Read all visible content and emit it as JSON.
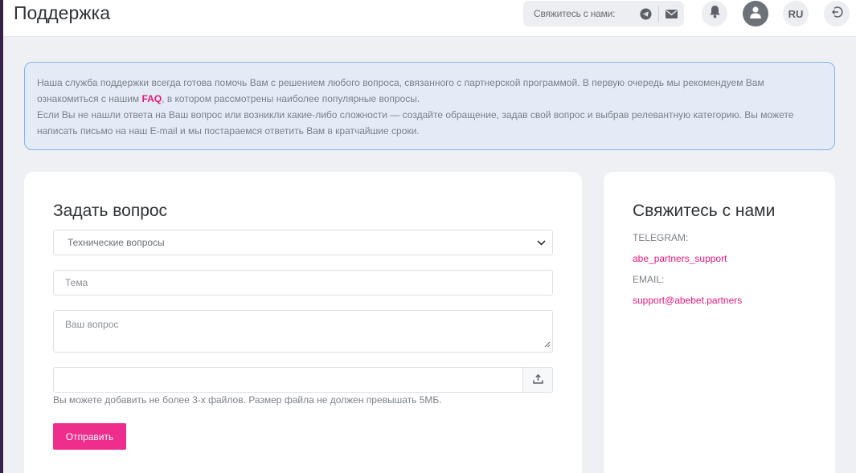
{
  "header": {
    "title": "Поддержка",
    "contact_label": "Свяжитесь с нами:",
    "language": "RU",
    "icons": [
      "telegram-icon",
      "mail-icon",
      "bell-icon",
      "user-icon",
      "logout-icon"
    ]
  },
  "info": {
    "line1_before": "Наша служба поддержки всегда готова помочь Вам с решением любого вопроса, связанного с партнерской программой. В первую очередь мы рекомендуем Вам ознакомиться с нашим ",
    "faq_link": "FAQ",
    "line1_after": ", в котором рассмотрены наиболее популярные вопросы.",
    "line2": "Если Вы не нашли ответа на Ваш вопрос или возникли какие-либо сложности — создайте обращение, задав свой вопрос и выбрав релевантную категорию. Вы можете написать письмо на наш E-mail и мы постараемся ответить Вам в кратчайшие сроки."
  },
  "form": {
    "title": "Задать вопрос",
    "category_selected": "Технические вопросы",
    "subject_placeholder": "Тема",
    "question_placeholder": "Ваш вопрос",
    "file_value": "",
    "file_hint": "Вы можете добавить не более 3-х файлов. Размер файла не должен превышать 5МБ.",
    "submit_label": "Отправить"
  },
  "contacts": {
    "title": "Свяжитесь с нами",
    "telegram_label": "TELEGRAM:",
    "telegram_value": "abe_partners_support",
    "email_label": "EMAIL:",
    "email_value": "support@abebet.partners"
  },
  "colors": {
    "accent": "#ee2d8c",
    "info_border": "#7fb3ec",
    "info_bg": "#e4ebf7"
  }
}
